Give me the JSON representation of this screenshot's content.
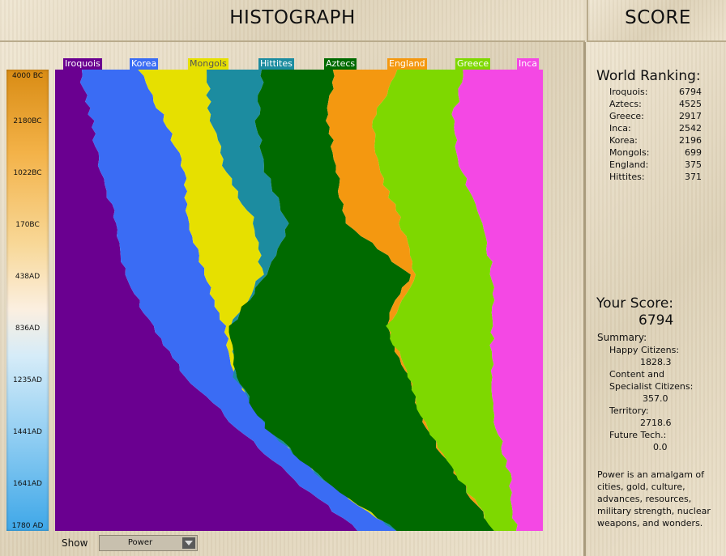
{
  "header": {
    "histograph_title": "HISTOGRAPH",
    "score_title": "SCORE"
  },
  "timeline": [
    "4000 BC",
    "2180BC",
    "1022BC",
    "170BC",
    "438AD",
    "836AD",
    "1235AD",
    "1441AD",
    "1641AD",
    "1780 AD"
  ],
  "civ_legend": [
    {
      "name": "Iroquois",
      "color": "#6a0090"
    },
    {
      "name": "Korea",
      "color": "#3a6cf4"
    },
    {
      "name": "Mongols",
      "color": "#e6e000"
    },
    {
      "name": "Hittites",
      "color": "#1c8ca0"
    },
    {
      "name": "Aztecs",
      "color": "#006a00"
    },
    {
      "name": "England",
      "color": "#f49810"
    },
    {
      "name": "Greece",
      "color": "#7ed800"
    },
    {
      "name": "Inca",
      "color": "#f448e4"
    }
  ],
  "chart_data": {
    "type": "area",
    "stacked": "percent",
    "metric": "Power",
    "x": [
      "4000 BC",
      "2180BC",
      "1022BC",
      "170BC",
      "438AD",
      "836AD",
      "1235AD",
      "1441AD",
      "1641AD",
      "1780 AD"
    ],
    "series": [
      {
        "name": "Iroquois",
        "values": [
          5.0,
          7.5,
          9.5,
          12.5,
          15.5,
          20.0,
          27.0,
          37.5,
          49.0,
          62.0
        ]
      },
      {
        "name": "Korea",
        "values": [
          12.5,
          15.0,
          17.0,
          14.5,
          18.5,
          14.5,
          10.0,
          6.0,
          6.0,
          8.0
        ]
      },
      {
        "name": "Mongols",
        "values": [
          13.5,
          9.5,
          8.5,
          14.0,
          12.5,
          1.5,
          0,
          0,
          0,
          0
        ]
      },
      {
        "name": "Hittites",
        "values": [
          11.5,
          9.5,
          8.0,
          7.0,
          1.0,
          0,
          0,
          0,
          0,
          0
        ]
      },
      {
        "name": "Aztecs",
        "values": [
          14.5,
          14.5,
          14.5,
          12.0,
          32.5,
          31.5,
          35.5,
          32.5,
          28.0,
          20.0
        ]
      },
      {
        "name": "England",
        "values": [
          13.0,
          9.0,
          9.0,
          11.0,
          1.5,
          0.5,
          0,
          0,
          0,
          0
        ]
      },
      {
        "name": "Greece",
        "values": [
          14.0,
          16.5,
          17.0,
          17.0,
          17.0,
          21.5,
          17.0,
          14.5,
          10.5,
          4.5
        ]
      },
      {
        "name": "Inca",
        "values": [
          16.0,
          18.5,
          16.5,
          12.0,
          11.5,
          10.5,
          10.5,
          9.5,
          6.5,
          5.5
        ]
      }
    ]
  },
  "show_control": {
    "label": "Show",
    "value": "Power"
  },
  "ranking": {
    "title": "World Ranking:",
    "rows": [
      {
        "name": "Iroquois:",
        "score": "6794"
      },
      {
        "name": "Aztecs:",
        "score": "4525"
      },
      {
        "name": "Greece:",
        "score": "2917"
      },
      {
        "name": "Inca:",
        "score": "2542"
      },
      {
        "name": "Korea:",
        "score": "2196"
      },
      {
        "name": "Mongols:",
        "score": "699"
      },
      {
        "name": "England:",
        "score": "375"
      },
      {
        "name": "Hittites:",
        "score": "371"
      }
    ]
  },
  "your_score": {
    "title": "Your Score:",
    "value": "6794",
    "summary_label": "Summary:",
    "happy_label": "Happy Citizens:",
    "happy_value": "1828.3",
    "content_label_1": "Content and",
    "content_label_2": "Specialist Citizens:",
    "content_value": "357.0",
    "territory_label": "Territory:",
    "territory_value": "2718.6",
    "future_label": "Future Tech.:",
    "future_value": "0.0"
  },
  "power_note": [
    "Power is an amalgam of",
    "cities, gold, culture,",
    "advances, resources,",
    "military strength, nuclear",
    "weapons, and wonders."
  ]
}
